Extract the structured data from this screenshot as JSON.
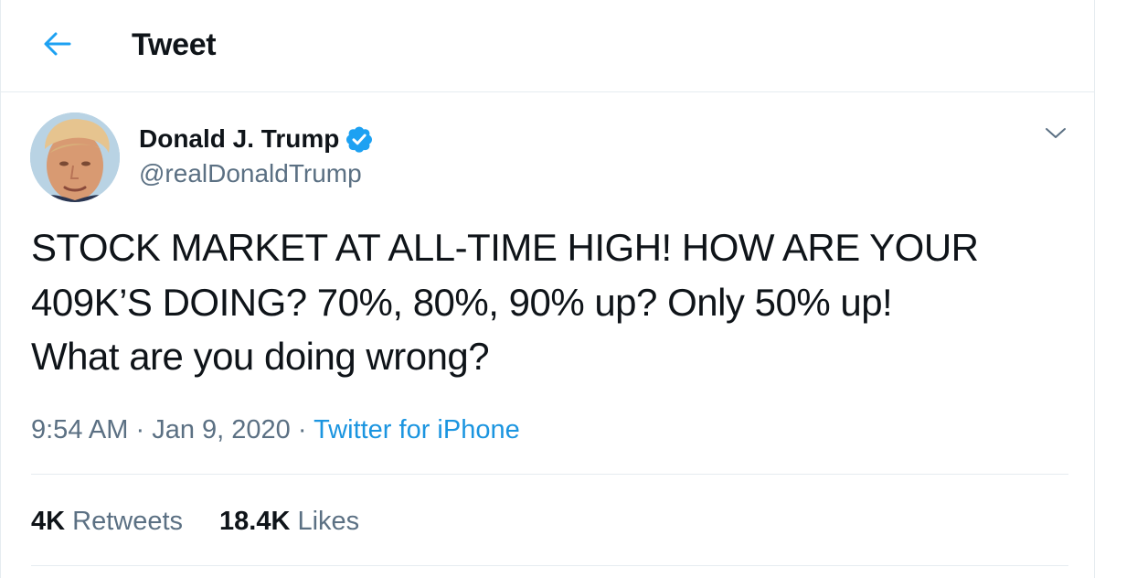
{
  "header": {
    "title": "Tweet",
    "back_icon": "arrow-left-icon"
  },
  "tweet": {
    "author_name": "Donald J. Trump",
    "handle": "@realDonaldTrump",
    "verified_icon": "verified-badge-icon",
    "text_lines": [
      "STOCK MARKET AT ALL-TIME HIGH! HOW ARE YOUR",
      "409K’S DOING? 70%, 80%, 90% up? Only 50% up!",
      "What are you doing wrong?"
    ],
    "time": "9:54 AM",
    "date": "Jan 9, 2020",
    "separator": "·",
    "source": "Twitter for iPhone",
    "retweets_count": "4K",
    "retweets_label": "Retweets",
    "likes_count": "18.4K",
    "likes_label": "Likes"
  },
  "colors": {
    "accent": "#1da1f2",
    "link": "#1b95e0",
    "secondary_text": "#5b7083",
    "border": "#e6ecf0"
  }
}
